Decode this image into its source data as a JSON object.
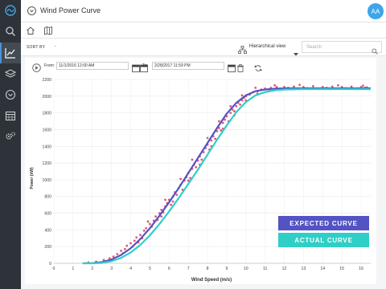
{
  "header": {
    "title": "Wind Power Curve",
    "avatar_initials": "AA"
  },
  "toolbar": {
    "sort_by_label": "SORT BY",
    "sort_value": "-",
    "view_label": "Hierarchical view",
    "search_placeholder": "Search"
  },
  "date_range": {
    "from_label": "From:",
    "from_value": "11/1/2016 12:00 AM",
    "to_label": "To:",
    "to_value": "2/28/2017 11:59 PM"
  },
  "colors": {
    "expected": "#5353c4",
    "actual": "#2ecfc6",
    "scatter": "#d81f4e",
    "sidebar": "#2d3339"
  },
  "legend": {
    "expected_label": "EXPECTED CURVE",
    "actual_label": "ACTUAL CURVE"
  },
  "chart_data": {
    "type": "scatter",
    "xlabel": "Wind Speed (m/s)",
    "ylabel": "Power (kW)",
    "xlim": [
      0,
      16.5
    ],
    "ylim": [
      0,
      2200
    ],
    "xticks": [
      0,
      1,
      2,
      3,
      4,
      5,
      6,
      7,
      8,
      9,
      10,
      11,
      12,
      13,
      14,
      15,
      16
    ],
    "yticks": [
      0,
      200,
      400,
      600,
      800,
      1000,
      1200,
      1400,
      1600,
      1800,
      2000,
      2200
    ],
    "grid": true,
    "series": [
      {
        "name": "EXPECTED CURVE",
        "type": "line",
        "x": [
          1.5,
          2,
          2.5,
          3,
          3.5,
          4,
          4.5,
          5,
          5.5,
          6,
          6.5,
          7,
          7.5,
          8,
          8.5,
          9,
          9.5,
          10,
          10.5,
          11,
          11.5,
          12,
          13,
          14,
          15,
          16.5
        ],
        "y": [
          0,
          2,
          15,
          45,
          100,
          180,
          290,
          420,
          570,
          730,
          900,
          1080,
          1260,
          1440,
          1620,
          1790,
          1920,
          2010,
          2060,
          2080,
          2090,
          2095,
          2095,
          2095,
          2095,
          2095
        ]
      },
      {
        "name": "ACTUAL CURVE",
        "type": "line",
        "x": [
          1.5,
          2,
          2.5,
          3,
          3.5,
          4,
          4.5,
          5,
          5.5,
          6,
          6.5,
          7,
          7.5,
          8,
          8.5,
          9,
          9.5,
          10,
          10.5,
          11,
          11.5,
          12,
          13,
          14,
          15,
          16.5
        ],
        "y": [
          0,
          0,
          5,
          25,
          65,
          130,
          220,
          335,
          470,
          620,
          780,
          950,
          1120,
          1300,
          1480,
          1650,
          1810,
          1930,
          2010,
          2050,
          2070,
          2080,
          2085,
          2085,
          2085,
          2085
        ]
      },
      {
        "name": "",
        "type": "scatter",
        "points": [
          [
            1.8,
            10
          ],
          [
            2.2,
            20
          ],
          [
            2.6,
            40
          ],
          [
            2.9,
            60
          ],
          [
            3.1,
            80
          ],
          [
            3.3,
            110
          ],
          [
            3.5,
            150
          ],
          [
            3.7,
            170
          ],
          [
            3.8,
            210
          ],
          [
            4.0,
            240
          ],
          [
            4.1,
            200
          ],
          [
            4.2,
            270
          ],
          [
            4.3,
            310
          ],
          [
            4.5,
            340
          ],
          [
            4.6,
            300
          ],
          [
            4.7,
            390
          ],
          [
            4.8,
            420
          ],
          [
            5.0,
            470
          ],
          [
            5.1,
            440
          ],
          [
            5.2,
            510
          ],
          [
            5.3,
            560
          ],
          [
            5.4,
            520
          ],
          [
            5.5,
            600
          ],
          [
            5.6,
            640
          ],
          [
            5.7,
            610
          ],
          [
            5.8,
            680
          ],
          [
            5.9,
            720
          ],
          [
            6.0,
            760
          ],
          [
            6.1,
            700
          ],
          [
            6.2,
            800
          ],
          [
            6.3,
            850
          ],
          [
            6.4,
            820
          ],
          [
            6.5,
            900
          ],
          [
            6.6,
            940
          ],
          [
            6.7,
            880
          ],
          [
            6.8,
            990
          ],
          [
            6.9,
            1030
          ],
          [
            7.0,
            1080
          ],
          [
            7.1,
            1020
          ],
          [
            7.2,
            1130
          ],
          [
            7.3,
            1180
          ],
          [
            7.4,
            1150
          ],
          [
            7.5,
            1230
          ],
          [
            7.6,
            1280
          ],
          [
            7.7,
            1240
          ],
          [
            7.8,
            1330
          ],
          [
            7.9,
            1380
          ],
          [
            8.0,
            1420
          ],
          [
            8.1,
            1360
          ],
          [
            8.2,
            1470
          ],
          [
            8.3,
            1520
          ],
          [
            8.4,
            1490
          ],
          [
            8.5,
            1580
          ],
          [
            8.6,
            1620
          ],
          [
            8.7,
            1590
          ],
          [
            8.8,
            1680
          ],
          [
            8.9,
            1720
          ],
          [
            9.0,
            1760
          ],
          [
            9.1,
            1700
          ],
          [
            9.2,
            1800
          ],
          [
            9.3,
            1840
          ],
          [
            9.4,
            1820
          ],
          [
            9.5,
            1880
          ],
          [
            9.6,
            1920
          ],
          [
            9.7,
            1900
          ],
          [
            9.8,
            1950
          ],
          [
            9.9,
            1980
          ],
          [
            10.0,
            2000
          ],
          [
            10.2,
            2020
          ],
          [
            10.4,
            2050
          ],
          [
            10.6,
            2060
          ],
          [
            10.8,
            2080
          ],
          [
            11.0,
            2090
          ],
          [
            11.3,
            2100
          ],
          [
            11.6,
            2110
          ],
          [
            12.0,
            2110
          ],
          [
            12.5,
            2115
          ],
          [
            13.0,
            2110
          ],
          [
            13.5,
            2120
          ],
          [
            14.0,
            2110
          ],
          [
            14.5,
            2115
          ],
          [
            15.0,
            2110
          ],
          [
            15.5,
            2115
          ],
          [
            16.0,
            2110
          ],
          [
            16.3,
            2105
          ],
          [
            3.0,
            30
          ],
          [
            3.6,
            120
          ],
          [
            4.4,
            250
          ],
          [
            5.6,
            560
          ],
          [
            6.2,
            740
          ],
          [
            7.0,
            990
          ],
          [
            7.6,
            1180
          ],
          [
            8.2,
            1400
          ],
          [
            8.8,
            1610
          ],
          [
            9.4,
            1770
          ],
          [
            10.0,
            1950
          ],
          [
            10.6,
            2030
          ],
          [
            11.2,
            2080
          ],
          [
            12.2,
            2100
          ],
          [
            13.2,
            2095
          ],
          [
            14.2,
            2100
          ],
          [
            15.2,
            2095
          ],
          [
            16.2,
            2100
          ],
          [
            4.9,
            500
          ],
          [
            5.8,
            760
          ],
          [
            6.6,
            1010
          ],
          [
            7.2,
            1240
          ],
          [
            8.0,
            1500
          ],
          [
            8.6,
            1700
          ],
          [
            9.2,
            1880
          ],
          [
            9.8,
            2010
          ],
          [
            10.5,
            2100
          ],
          [
            11.5,
            2130
          ],
          [
            12.8,
            2135
          ],
          [
            14.8,
            2130
          ],
          [
            16.1,
            2125
          ]
        ]
      }
    ]
  }
}
